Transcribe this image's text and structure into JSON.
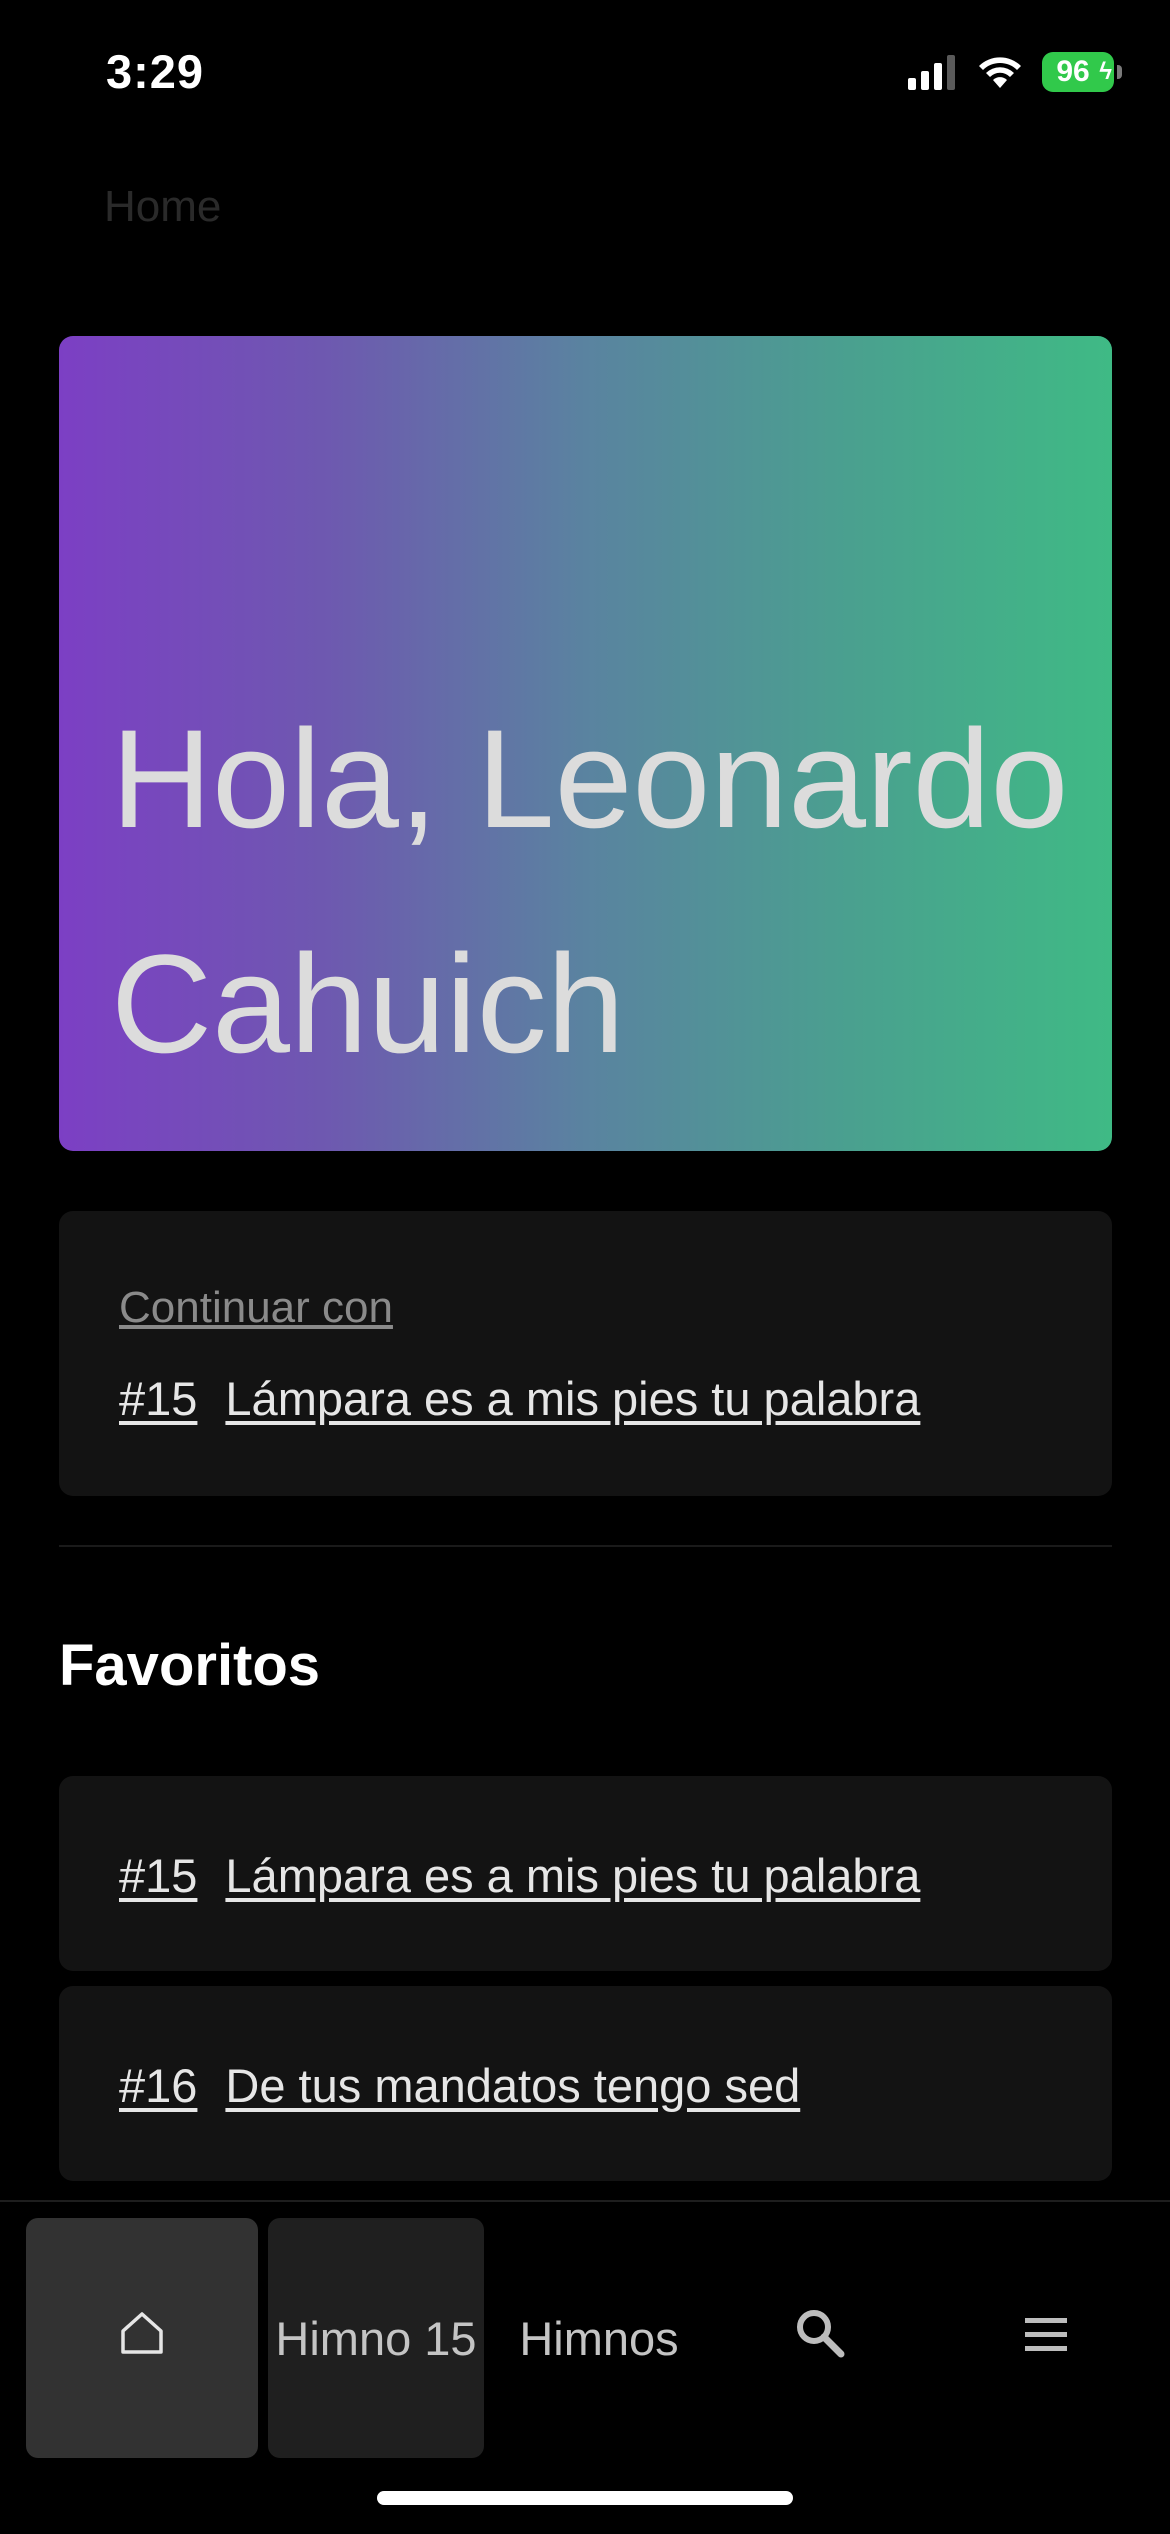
{
  "status_bar": {
    "time": "3:29",
    "battery": "96"
  },
  "breadcrumb": "Home",
  "hero": {
    "greeting": "Hola, Leonardo Cahuich"
  },
  "continue": {
    "label": "Continuar con",
    "number": "#15",
    "title": "Lámpara es a mis pies tu palabra"
  },
  "favorites": {
    "title": "Favoritos",
    "items": [
      {
        "number": "#15",
        "title": "Lámpara es a mis pies tu palabra"
      },
      {
        "number": "#16",
        "title": "De tus mandatos tengo sed"
      }
    ]
  },
  "tab_bar": {
    "home_icon": "home-icon",
    "hymn_tab": "Himno 15",
    "hymns_tab": "Himnos",
    "search_icon": "search-icon",
    "menu_icon": "menu-icon"
  }
}
